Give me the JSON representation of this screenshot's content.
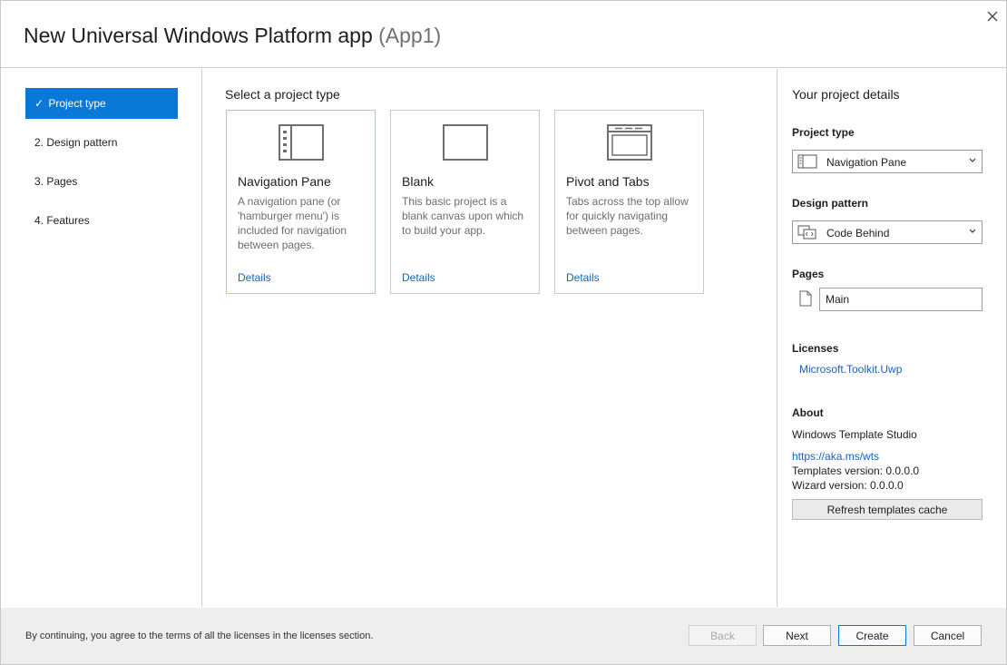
{
  "window": {
    "title": "New Universal Windows Platform app",
    "app_name": "(App1)",
    "close_glyph": "✕"
  },
  "steps": [
    {
      "label": "Project type",
      "prefix": "✓",
      "active": true
    },
    {
      "label": "2.  Design pattern"
    },
    {
      "label": "3.  Pages"
    },
    {
      "label": "4.  Features"
    }
  ],
  "main": {
    "title": "Select a project type",
    "cards": [
      {
        "name": "Navigation Pane",
        "description": "A navigation pane (or 'hamburger menu') is included for navigation between pages.",
        "details": "Details",
        "icon": "navigation-pane-icon",
        "selected": true
      },
      {
        "name": "Blank",
        "description": "This basic project is a blank canvas upon which to build your app.",
        "details": "Details",
        "icon": "blank-icon"
      },
      {
        "name": "Pivot and Tabs",
        "description": "Tabs across the top allow for quickly navigating between pages.",
        "details": "Details",
        "icon": "pivot-tabs-icon"
      }
    ]
  },
  "details": {
    "header": "Your project details",
    "project_type_label": "Project type",
    "project_type_value": "Navigation Pane",
    "design_pattern_label": "Design pattern",
    "design_pattern_value": "Code Behind",
    "pages_label": "Pages",
    "page_value": "Main",
    "licenses_label": "Licenses",
    "license_link": "Microsoft.Toolkit.Uwp",
    "about_label": "About",
    "about_name": "Windows Template Studio",
    "about_link": "https://aka.ms/wts",
    "templates_version": "Templates version: 0.0.0.0",
    "wizard_version": "Wizard version: 0.0.0.0",
    "refresh_button": "Refresh templates cache"
  },
  "footer": {
    "note": "By continuing, you agree to the terms of all the licenses in the licenses section.",
    "back": "Back",
    "next": "Next",
    "create": "Create",
    "cancel": "Cancel"
  },
  "colors": {
    "accent": "#0a78d7",
    "link": "#1a62b6",
    "selected_border": "#e0c56b"
  }
}
